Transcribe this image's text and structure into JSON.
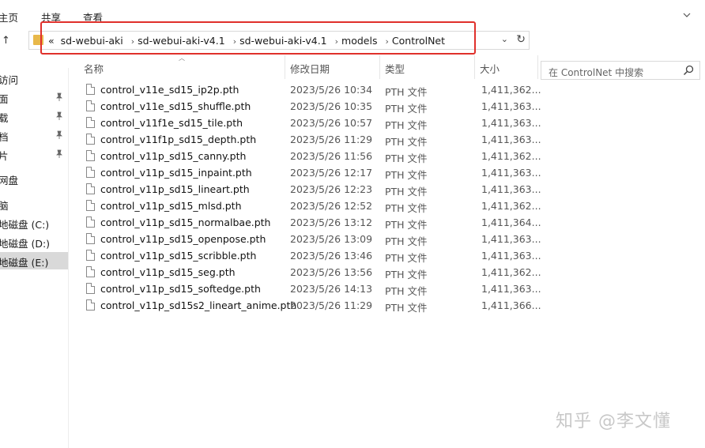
{
  "ribbon": {
    "tabs": [
      "主页",
      "共享",
      "查看"
    ]
  },
  "address_bar": {
    "prefix": "«",
    "crumbs": [
      "sd-webui-aki",
      "sd-webui-aki-v4.1",
      "sd-webui-aki-v4.1",
      "models",
      "ControlNet"
    ],
    "separator": "›",
    "dropdown": "⌄",
    "refresh": "↻"
  },
  "search": {
    "placeholder": "在 ControlNet 中搜索"
  },
  "sidebar": {
    "items": [
      {
        "label": "访问",
        "pinned": false,
        "selected": false
      },
      {
        "label": "面",
        "pinned": true,
        "selected": false
      },
      {
        "label": "载",
        "pinned": true,
        "selected": false
      },
      {
        "label": "档",
        "pinned": true,
        "selected": false
      },
      {
        "label": "片",
        "pinned": true,
        "selected": false
      },
      {
        "label": "网盘",
        "pinned": false,
        "selected": false
      },
      {
        "label": "脑",
        "pinned": false,
        "selected": false
      },
      {
        "label": "地磁盘 (C:)",
        "pinned": false,
        "selected": false
      },
      {
        "label": "地磁盘 (D:)",
        "pinned": false,
        "selected": false
      },
      {
        "label": "地磁盘 (E:)",
        "pinned": false,
        "selected": true
      }
    ]
  },
  "columns": {
    "name": "名称",
    "date": "修改日期",
    "type": "类型",
    "size": "大小"
  },
  "files": [
    {
      "name": "control_v11e_sd15_ip2p.pth",
      "date": "2023/5/26 10:34",
      "type": "PTH 文件",
      "size": "1,411,362..."
    },
    {
      "name": "control_v11e_sd15_shuffle.pth",
      "date": "2023/5/26 10:35",
      "type": "PTH 文件",
      "size": "1,411,363..."
    },
    {
      "name": "control_v11f1e_sd15_tile.pth",
      "date": "2023/5/26 10:57",
      "type": "PTH 文件",
      "size": "1,411,363..."
    },
    {
      "name": "control_v11f1p_sd15_depth.pth",
      "date": "2023/5/26 11:29",
      "type": "PTH 文件",
      "size": "1,411,363..."
    },
    {
      "name": "control_v11p_sd15_canny.pth",
      "date": "2023/5/26 11:56",
      "type": "PTH 文件",
      "size": "1,411,362..."
    },
    {
      "name": "control_v11p_sd15_inpaint.pth",
      "date": "2023/5/26 12:17",
      "type": "PTH 文件",
      "size": "1,411,363..."
    },
    {
      "name": "control_v11p_sd15_lineart.pth",
      "date": "2023/5/26 12:23",
      "type": "PTH 文件",
      "size": "1,411,363..."
    },
    {
      "name": "control_v11p_sd15_mlsd.pth",
      "date": "2023/5/26 12:52",
      "type": "PTH 文件",
      "size": "1,411,362..."
    },
    {
      "name": "control_v11p_sd15_normalbae.pth",
      "date": "2023/5/26 13:12",
      "type": "PTH 文件",
      "size": "1,411,364..."
    },
    {
      "name": "control_v11p_sd15_openpose.pth",
      "date": "2023/5/26 13:09",
      "type": "PTH 文件",
      "size": "1,411,363..."
    },
    {
      "name": "control_v11p_sd15_scribble.pth",
      "date": "2023/5/26 13:46",
      "type": "PTH 文件",
      "size": "1,411,363..."
    },
    {
      "name": "control_v11p_sd15_seg.pth",
      "date": "2023/5/26 13:56",
      "type": "PTH 文件",
      "size": "1,411,362..."
    },
    {
      "name": "control_v11p_sd15_softedge.pth",
      "date": "2023/5/26 14:13",
      "type": "PTH 文件",
      "size": "1,411,363..."
    },
    {
      "name": "control_v11p_sd15s2_lineart_anime.pth",
      "date": "2023/5/26 11:29",
      "type": "PTH 文件",
      "size": "1,411,366..."
    }
  ],
  "watermark": "知乎 @李文懂",
  "colors": {
    "highlight": "#e0302b",
    "folder": "#e8b84a",
    "selected_bg": "#d9d9d9"
  },
  "icons": {
    "nav_up": "arrow-up-icon",
    "search": "search-icon",
    "pin": "pin-icon",
    "file": "file-icon",
    "folder": "folder-icon"
  }
}
